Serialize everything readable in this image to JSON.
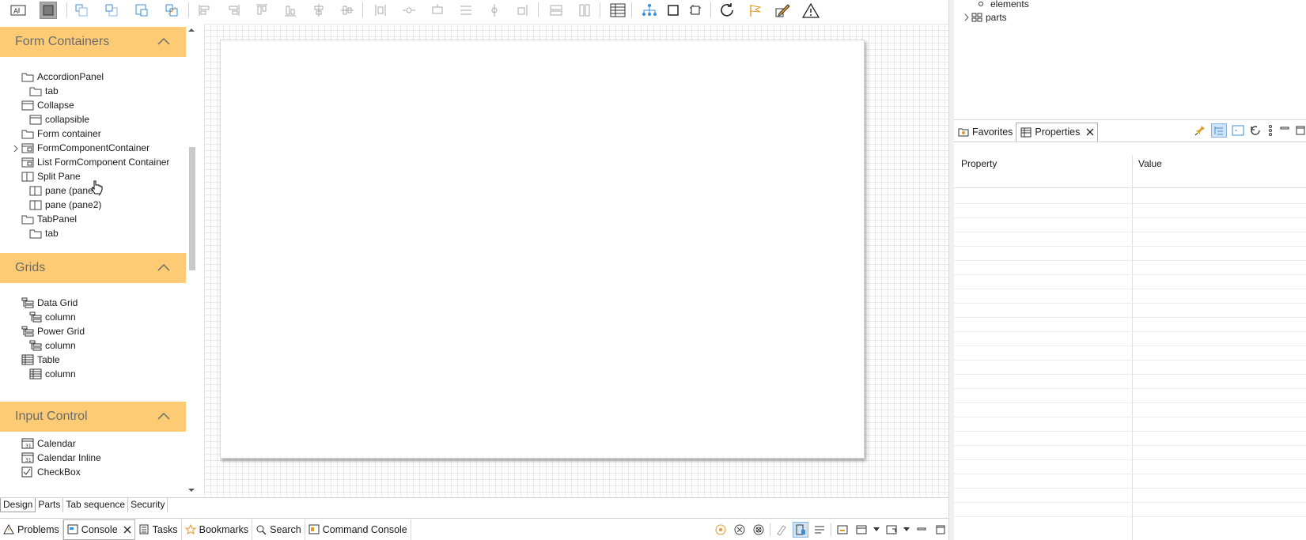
{
  "palette": {
    "sections": [
      {
        "title": "Form Containers",
        "items": [
          {
            "label": "AccordionPanel",
            "indent": 0,
            "icon": "folder-icon"
          },
          {
            "label": "tab",
            "indent": 1,
            "icon": "folder-icon"
          },
          {
            "label": "Collapse",
            "indent": 0,
            "icon": "window-icon"
          },
          {
            "label": "collapsible",
            "indent": 1,
            "icon": "window-icon"
          },
          {
            "label": "Form container",
            "indent": 0,
            "icon": "folder-icon"
          },
          {
            "label": "FormComponentContainer",
            "indent": 0,
            "icon": "container-icon",
            "expandable": true
          },
          {
            "label": "List FormComponent Container",
            "indent": 0,
            "icon": "container-icon"
          },
          {
            "label": "Split Pane",
            "indent": 0,
            "icon": "split-icon"
          },
          {
            "label": "pane (pane1)",
            "indent": 1,
            "icon": "split-icon"
          },
          {
            "label": "pane (pane2)",
            "indent": 1,
            "icon": "split-icon"
          },
          {
            "label": "TabPanel",
            "indent": 0,
            "icon": "folder-icon"
          },
          {
            "label": "tab",
            "indent": 1,
            "icon": "folder-icon"
          }
        ]
      },
      {
        "title": "Grids",
        "items": [
          {
            "label": "Data Grid",
            "indent": 0,
            "icon": "grid-icon"
          },
          {
            "label": "column",
            "indent": 1,
            "icon": "grid-icon"
          },
          {
            "label": "Power Grid",
            "indent": 0,
            "icon": "grid-icon"
          },
          {
            "label": "column",
            "indent": 1,
            "icon": "grid-icon"
          },
          {
            "label": "Table",
            "indent": 0,
            "icon": "table-icon"
          },
          {
            "label": "column",
            "indent": 1,
            "icon": "table-icon"
          }
        ]
      },
      {
        "title": "Input Control",
        "items": [
          {
            "label": "Calendar",
            "indent": 0,
            "icon": "calendar-icon"
          },
          {
            "label": "Calendar Inline",
            "indent": 0,
            "icon": "calendar-icon"
          },
          {
            "label": "CheckBox",
            "indent": 0,
            "icon": "checkbox-icon"
          }
        ]
      }
    ]
  },
  "design_tabs": [
    "Design",
    "Parts",
    "Tab sequence",
    "Security"
  ],
  "console_tabs": [
    {
      "label": "Problems",
      "icon": "warning-icon"
    },
    {
      "label": "Console",
      "icon": "console-icon",
      "active": true,
      "closable": true
    },
    {
      "label": "Tasks",
      "icon": "tasks-icon"
    },
    {
      "label": "Bookmarks",
      "icon": "bookmark-icon"
    },
    {
      "label": "Search",
      "icon": "search-icon"
    },
    {
      "label": "Command Console",
      "icon": "command-console-icon"
    }
  ],
  "outline": {
    "items": [
      {
        "label": "elements"
      },
      {
        "label": "parts"
      }
    ]
  },
  "properties_panel": {
    "tabs": [
      {
        "label": "Favorites",
        "icon": "favorites-icon"
      },
      {
        "label": "Properties",
        "icon": "properties-icon",
        "active": true,
        "closable": true
      }
    ],
    "columns": [
      "Property",
      "Value"
    ]
  },
  "colors": {
    "palette_header": "#fccb73",
    "accent_blue": "#3b8fd6"
  }
}
